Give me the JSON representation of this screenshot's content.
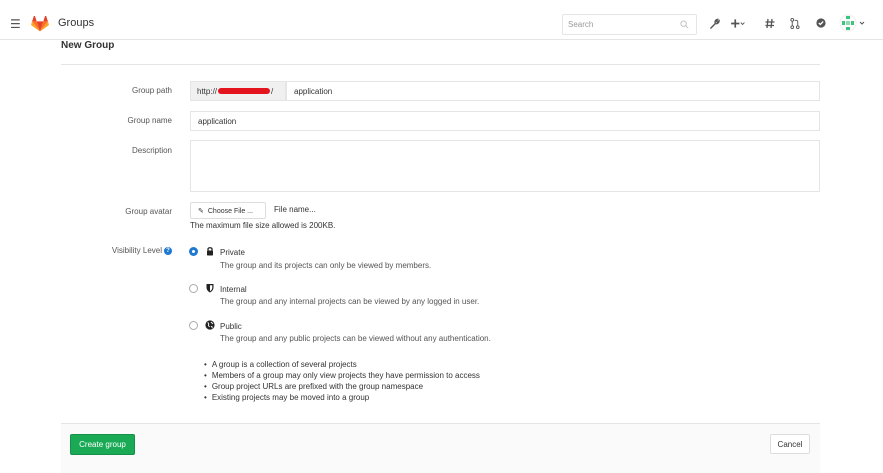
{
  "header": {
    "title": "Groups",
    "search_placeholder": "Search",
    "icons": [
      "hamburger-icon",
      "gitlab-logo",
      "search-icon",
      "wrench-icon",
      "plus-icon",
      "hash-icon",
      "merge-request-icon",
      "todo-check-icon",
      "avatar"
    ]
  },
  "page": {
    "title": "New Group"
  },
  "form": {
    "group_path": {
      "label": "Group path",
      "prefix_start": "http://",
      "prefix_end": "/",
      "value": "application"
    },
    "group_name": {
      "label": "Group name",
      "value": "application"
    },
    "description": {
      "label": "Description",
      "value": ""
    },
    "group_avatar": {
      "label": "Group avatar",
      "button_label": "Choose File ...",
      "file_name": "File name...",
      "help": "The maximum file size allowed is 200KB."
    },
    "visibility": {
      "label": "Visibility Level",
      "selected": "Private",
      "options": [
        {
          "name": "Private",
          "description": "The group and its projects can only be viewed by members."
        },
        {
          "name": "Internal",
          "description": "The group and any internal projects can be viewed by any logged in user."
        },
        {
          "name": "Public",
          "description": "The group and any public projects can be viewed without any authentication."
        }
      ]
    },
    "notes": [
      "A group is a collection of several projects",
      "Members of a group may only view projects they have permission to access",
      "Group project URLs are prefixed with the group namespace",
      "Existing projects may be moved into a group"
    ]
  },
  "actions": {
    "create_label": "Create group",
    "cancel_label": "Cancel"
  },
  "colors": {
    "primary_blue": "#1f78d1",
    "create_green": "#1aaa55",
    "redaction_red": "#e3141d"
  }
}
